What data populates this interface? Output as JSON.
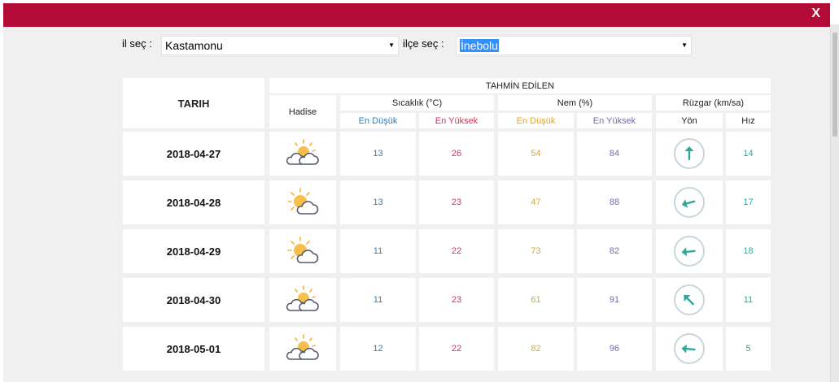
{
  "modal": {
    "close_label": "X"
  },
  "selectors": {
    "il_label": "il seç :",
    "il_value": "Kastamonu",
    "ilce_label": "ilçe seç :",
    "ilce_value": "İnebolu"
  },
  "table": {
    "tarih_header": "TARIH",
    "tahmin_header": "TAHMİN EDİLEN",
    "hadise_header": "Hadise",
    "sicaklik_header": "Sıcaklık (°C)",
    "nem_header": "Nem (%)",
    "ruzgar_header": "Rüzgar (km/sa)",
    "en_dusuk": "En Düşük",
    "en_yuksek": "En Yüksek",
    "yon_header": "Yön",
    "hiz_header": "Hız",
    "rows": [
      {
        "date": "2018-04-27",
        "icon": "partly-cloudy-sun-icon",
        "temp_min": "13",
        "temp_max": "26",
        "hum_min": "54",
        "hum_max": "84",
        "wind_dir_icon": "arrow-up-icon",
        "wind_deg": 0,
        "wind_speed": "14"
      },
      {
        "date": "2018-04-28",
        "icon": "partly-cloudy-sun-icon",
        "temp_min": "13",
        "temp_max": "23",
        "hum_min": "47",
        "hum_max": "88",
        "wind_dir_icon": "arrow-left-down-icon",
        "wind_deg": 255,
        "wind_speed": "17"
      },
      {
        "date": "2018-04-29",
        "icon": "partly-cloudy-sun-icon",
        "temp_min": "11",
        "temp_max": "22",
        "hum_min": "73",
        "hum_max": "82",
        "wind_dir_icon": "arrow-left-icon",
        "wind_deg": 265,
        "wind_speed": "18"
      },
      {
        "date": "2018-04-30",
        "icon": "partly-cloudy-sun-icon",
        "temp_min": "11",
        "temp_max": "23",
        "hum_min": "61",
        "hum_max": "91",
        "wind_dir_icon": "arrow-up-left-icon",
        "wind_deg": 315,
        "wind_speed": "11"
      },
      {
        "date": "2018-05-01",
        "icon": "partly-cloudy-sun-icon",
        "temp_min": "12",
        "temp_max": "22",
        "hum_min": "82",
        "hum_max": "96",
        "wind_dir_icon": "arrow-left-icon",
        "wind_deg": 275,
        "wind_speed": "5"
      }
    ]
  },
  "colors": {
    "titlebar": "#b20b35",
    "min_temp": "#2d7fb8",
    "max_temp": "#d2375a",
    "min_hum": "#e3a528",
    "max_hum": "#7c68b0",
    "wind": "#2fa89a"
  }
}
